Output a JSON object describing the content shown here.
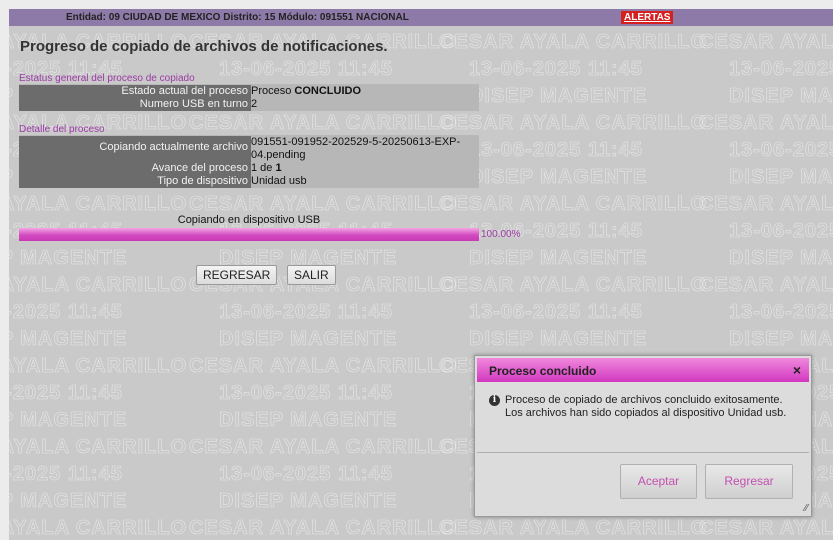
{
  "topbar": {
    "info": "Entidad: 09 CIUDAD DE MEXICO Distrito: 15 Módulo: 091551 NACIONAL",
    "alerts_label": "ALERTAS"
  },
  "page": {
    "title": "Progreso de copiado de archivos de notificaciones."
  },
  "status_section": {
    "label": "Estatus general del proceso de copiado",
    "rows": [
      {
        "label": "Estado actual del proceso",
        "value_prefix": "Proceso ",
        "value_bold": "CONCLUIDO"
      },
      {
        "label": "Numero USB en turno",
        "value": "2"
      }
    ]
  },
  "detail_section": {
    "label": "Detalle del proceso",
    "rows": [
      {
        "label": "Copiando actualmente archivo",
        "value": "091551-091952-202529-5-20250613-EXP-04.pending"
      },
      {
        "label": "Avance del proceso",
        "value_prefix": "1 de ",
        "value_bold": "1"
      },
      {
        "label": "Tipo de dispositivo",
        "value": "Unidad usb"
      }
    ]
  },
  "progress": {
    "label": "Copiando en dispositivo USB",
    "percent": 100,
    "percent_text": "100.00%"
  },
  "buttons": {
    "back": "REGRESAR",
    "exit": "SALIR"
  },
  "dialog": {
    "title": "Proceso concluido",
    "close": "×",
    "icon": "info-icon",
    "message": "Proceso de copiado de archivos concluido exitosamente. Los archivos han sido copiados al dispositivo Unidad usb.",
    "accept": "Aceptar",
    "back": "Regresar"
  },
  "watermark": {
    "line1": "CESAR AYALA CARRILLO",
    "line2": "13-06-2025 11:45",
    "line3": "DISEP MAGENTE"
  },
  "colors": {
    "topbar": "#8e7aa8",
    "accent": "#d24ac0",
    "alert": "#d61f1f"
  }
}
